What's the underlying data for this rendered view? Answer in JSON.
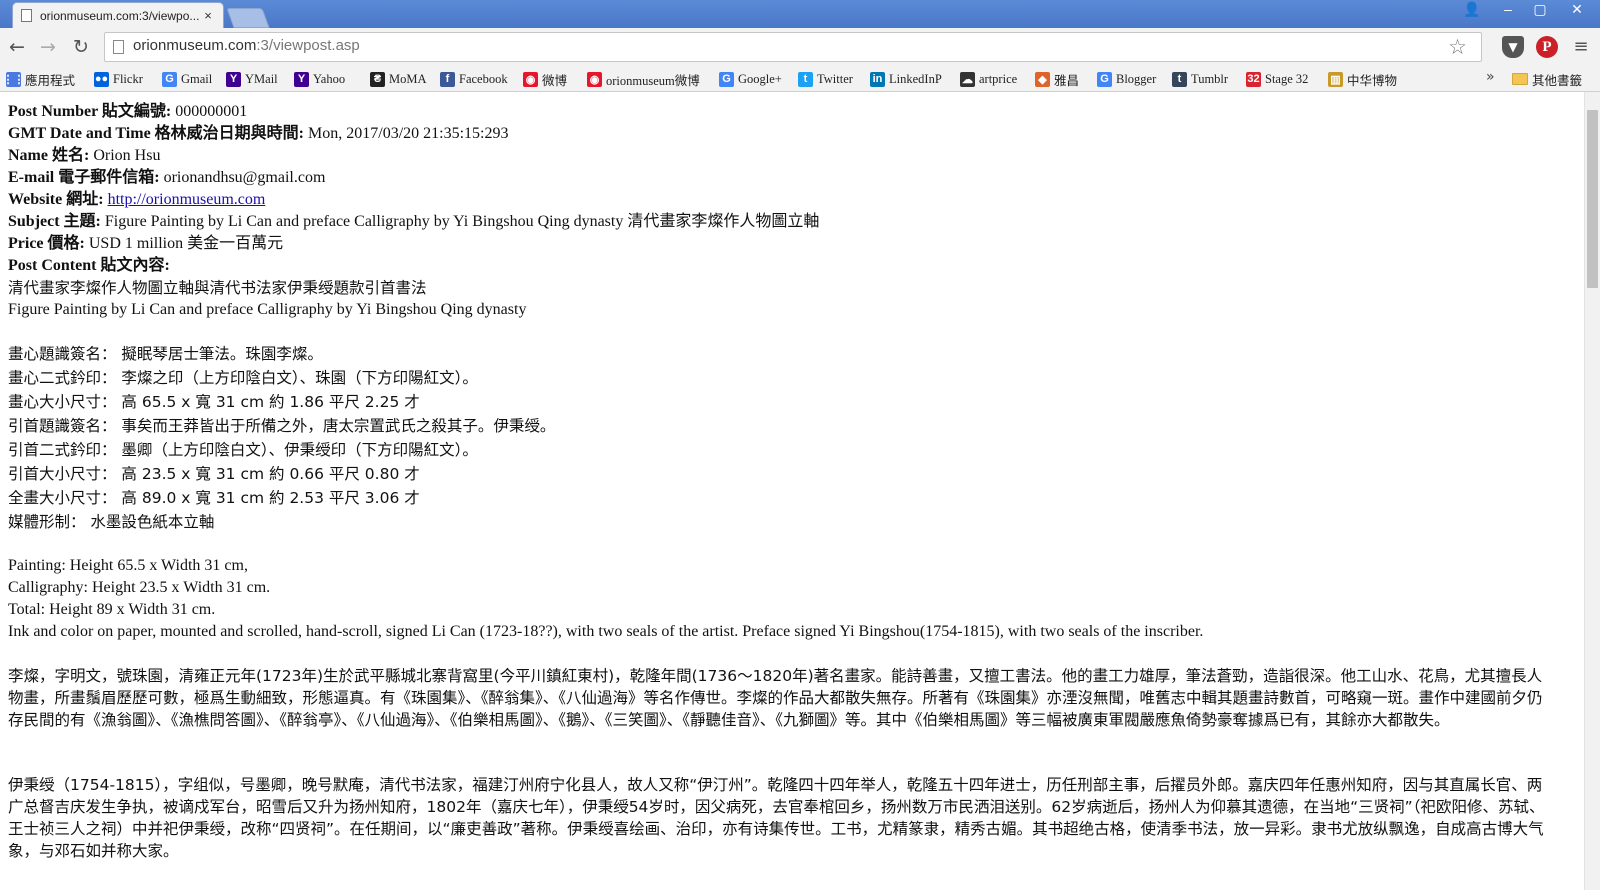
{
  "browser": {
    "tab_title": "orionmuseum.com:3/viewpo...",
    "tab_close": "×",
    "window_controls": {
      "user": "👤",
      "minimize": "–",
      "maximize": "▢",
      "close": "✕"
    },
    "nav": {
      "back": "←",
      "forward": "→",
      "reload": "↻"
    },
    "url_host": "orionmuseum.com",
    "url_path": ":3/viewpost.asp",
    "star": "☆",
    "ext_pocket": "▼",
    "ext_pinterest": "P",
    "menu": "≡"
  },
  "bookmarks": {
    "items": [
      {
        "label": "應用程式",
        "icon": "apps-grid-icon",
        "color": "#4a7ae0"
      },
      {
        "label": "Flickr",
        "icon": "flickr-icon",
        "color": "#0063dc"
      },
      {
        "label": "Gmail",
        "icon": "google-icon",
        "color": "#4285f4"
      },
      {
        "label": "YMail",
        "icon": "yahoo-icon",
        "color": "#400090"
      },
      {
        "label": "Yahoo",
        "icon": "yahoo-icon",
        "color": "#400090"
      },
      {
        "label": "MoMA",
        "icon": "moma-icon",
        "color": "#222222"
      },
      {
        "label": "Facebook",
        "icon": "facebook-icon",
        "color": "#3b5998"
      },
      {
        "label": "微博",
        "icon": "weibo-icon",
        "color": "#e6162d"
      },
      {
        "label": "orionmuseum微博",
        "icon": "weibo-icon",
        "color": "#e6162d"
      },
      {
        "label": "Google+",
        "icon": "google-icon",
        "color": "#4285f4"
      },
      {
        "label": "Twitter",
        "icon": "twitter-icon",
        "color": "#1da1f2"
      },
      {
        "label": "LinkedInP",
        "icon": "linkedin-icon",
        "color": "#0077b5"
      },
      {
        "label": "artprice",
        "icon": "artprice-icon",
        "color": "#333333"
      },
      {
        "label": "雅昌",
        "icon": "artron-icon",
        "color": "#e0632a"
      },
      {
        "label": "Blogger",
        "icon": "google-icon",
        "color": "#4285f4"
      },
      {
        "label": "Tumblr",
        "icon": "tumblr-icon",
        "color": "#35465c"
      },
      {
        "label": "Stage 32",
        "icon": "stage32-icon",
        "color": "#d9232e"
      },
      {
        "label": "中华博物",
        "icon": "museum-icon",
        "color": "#c89a2a"
      }
    ],
    "icon_glyphs": [
      "⋮⋮",
      "●●",
      "G",
      "Y",
      "Y",
      "₴",
      "f",
      "◉",
      "◉",
      "G",
      "t",
      "in",
      "☁",
      "◆",
      "G",
      "t",
      "32",
      "▥"
    ],
    "more": "»",
    "other_folder": "其他書籤"
  },
  "post": {
    "post_number_label": "Post Number 貼文編號:",
    "post_number_value": " 000000001",
    "date_label": "GMT Date and Time 格林威治日期與時間:",
    "date_value": " Mon, 2017/03/20 21:35:15:293",
    "name_label": "Name 姓名:",
    "name_value": " Orion Hsu",
    "email_label": "E-mail 電子郵件信箱:",
    "email_value": " orionandhsu@gmail.com",
    "website_label": "Website 網址:",
    "website_value": "http://orionmuseum.com",
    "subject_label": "Subject 主題:",
    "subject_value": " Figure Painting by Li Can and preface Calligraphy by Yi Bingshou Qing dynasty 清代畫家李燦作人物圖立軸",
    "price_label": "Price 價格:",
    "price_value": " USD 1 million 美金一百萬元",
    "content_label": "Post Content 貼文內容:"
  },
  "content": {
    "title_cn": "清代畫家李燦作人物圖立軸與清代书法家伊秉绶題款引首書法",
    "title_en": "Figure Painting by Li Can and preface Calligraphy by Yi Bingshou Qing dynasty",
    "details_cn": [
      "畫心題識簽名： 擬眠琴居士筆法。珠園李燦。",
      "畫心二式鈐印： 李燦之印（上方印陰白文）、珠園（下方印陽紅文）。",
      "畫心大小尺寸： 高 65.5 x 寬 31 cm 約 1.86 平尺 2.25 才",
      "引首題識簽名： 事矣而王莽皆出于所備之外，唐太宗置武氏之殺其子。伊秉绶。",
      "引首二式鈐印： 墨卿（上方印陰白文）、伊秉绶印（下方印陽紅文）。",
      "引首大小尺寸： 高 23.5 x 寬 31 cm 約 0.66 平尺 0.80 才",
      "全畫大小尺寸： 高 89.0 x 寬 31 cm 約 2.53 平尺 3.06 才",
      "媒體形制： 水墨設色紙本立軸"
    ],
    "details_en": [
      "Painting: Height 65.5 x Width 31 cm,",
      "Calligraphy: Height 23.5 x Width 31 cm.",
      "Total: Height 89 x Width 31 cm.",
      "Ink and color on paper, mounted and scrolled, hand-scroll, signed Li Can (1723-18??), with two seals of the artist. Preface signed Yi Bingshou(1754-1815), with two seals of the inscriber."
    ],
    "bio_li_can": "李燦，字明文，號珠園，清雍正元年(1723年)生於武平縣城北寨背窩里(今平川鎮紅東村)，乾隆年間(1736～1820年)著名畫家。能詩善畫，又擅工書法。他的畫工力雄厚，筆法蒼勁，造詣很深。他工山水、花鳥，尤其擅長人物畫，所畫鬚眉歷歷可數，極爲生動細致，形態逼真。有《珠園集》、《醉翁集》、《八仙過海》等名作傳世。李燦的作品大都散失無存。所著有《珠園集》亦湮沒無聞，唯舊志中輯其題畫詩數首，可略窺一斑。畫作中建國前夕仍存民間的有《漁翁圖》、《漁樵問答圖》、《醉翁亭》、《八仙過海》、《伯樂相馬圖》、《鵝》、《三笑圖》、《靜聽佳音》、《九獅圖》等。其中《伯樂相馬圖》等三幅被廣東軍閥嚴應魚倚勢豪奪據爲已有，其餘亦大都散失。",
    "bio_yi_bingshou": "伊秉绶（1754-1815），字组似，号墨卿，晚号默庵，清代书法家，福建汀州府宁化县人，故人又称“伊汀州”。乾隆四十四年举人，乾隆五十四年进士，历任刑部主事，后擢员外郎。嘉庆四年任惠州知府，因与其直属长官、两广总督吉庆发生争执，被谪戍军台，昭雪后又升为扬州知府，1802年（嘉庆七年），伊秉绶54岁时，因父病死，去官奉棺回乡，扬州数万市民洒泪送别。62岁病逝后，扬州人为仰慕其遗德，在当地“三贤祠”（祀欧阳修、苏轼、王士祯三人之祠）中并祀伊秉绶，改称“四贤祠”。在任期间，以“廉吏善政”著称。伊秉绶喜绘画、治印，亦有诗集传世。工书，尤精篆隶，精秀古媚。其书超绝古格，使清季书法，放一异彩。隶书尤放纵飘逸，自成高古博大气象，与邓石如并称大家。"
  }
}
